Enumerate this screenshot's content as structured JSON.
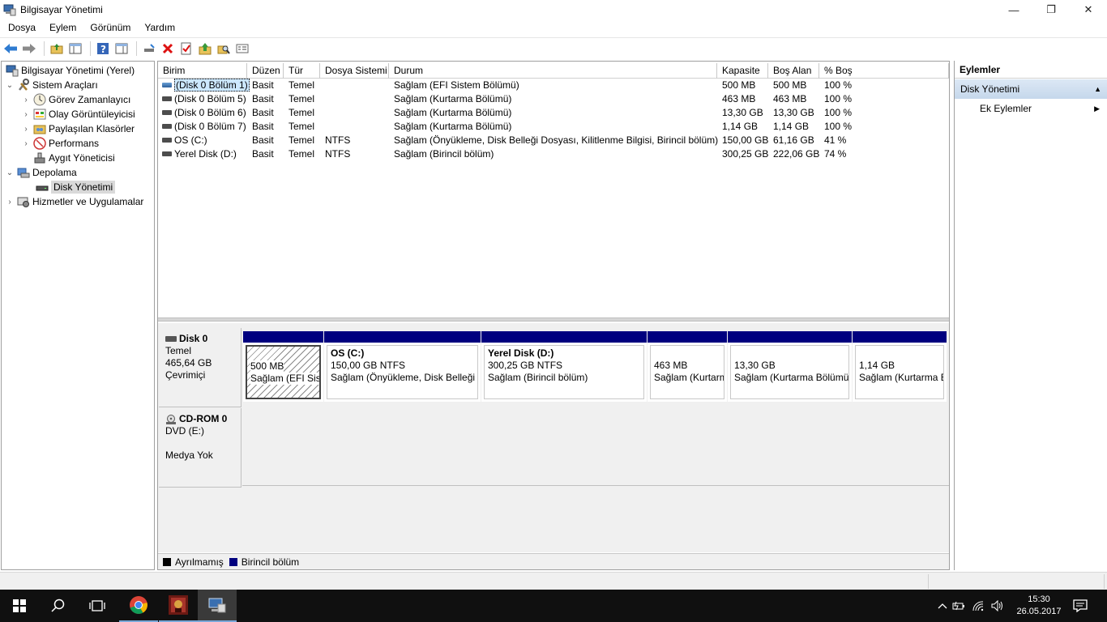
{
  "window": {
    "title": "Bilgisayar Yönetimi",
    "minimize": "—",
    "restore": "❐",
    "close": "✕"
  },
  "menu": [
    "Dosya",
    "Eylem",
    "Görünüm",
    "Yardım"
  ],
  "tree": {
    "root": "Bilgisayar Yönetimi (Yerel)",
    "system_tools": "Sistem Araçları",
    "task_scheduler": "Görev Zamanlayıcı",
    "event_viewer": "Olay Görüntüleyicisi",
    "shared_folders": "Paylaşılan Klasörler",
    "performance": "Performans",
    "device_manager": "Aygıt Yöneticisi",
    "storage": "Depolama",
    "disk_management": "Disk Yönetimi",
    "services": "Hizmetler ve Uygulamalar"
  },
  "grid": {
    "columns": [
      "Birim",
      "Düzen",
      "Tür",
      "Dosya Sistemi",
      "Durum",
      "Kapasite",
      "Boş Alan",
      "% Boş"
    ],
    "rows": [
      [
        "(Disk 0 Bölüm 1)",
        "Basit",
        "Temel",
        "",
        "Sağlam (EFI Sistem Bölümü)",
        "500 MB",
        "500 MB",
        "100 %"
      ],
      [
        "(Disk 0 Bölüm 5)",
        "Basit",
        "Temel",
        "",
        "Sağlam (Kurtarma Bölümü)",
        "463 MB",
        "463 MB",
        "100 %"
      ],
      [
        "(Disk 0 Bölüm 6)",
        "Basit",
        "Temel",
        "",
        "Sağlam (Kurtarma Bölümü)",
        "13,30 GB",
        "13,30 GB",
        "100 %"
      ],
      [
        "(Disk 0 Bölüm 7)",
        "Basit",
        "Temel",
        "",
        "Sağlam (Kurtarma Bölümü)",
        "1,14 GB",
        "1,14 GB",
        "100 %"
      ],
      [
        "OS (C:)",
        "Basit",
        "Temel",
        "NTFS",
        "Sağlam (Önyükleme, Disk Belleği Dosyası, Kilitlenme Bilgisi, Birincil bölüm)",
        "150,00 GB",
        "61,16 GB",
        "41 %"
      ],
      [
        "Yerel Disk (D:)",
        "Basit",
        "Temel",
        "NTFS",
        "Sağlam (Birincil bölüm)",
        "300,25 GB",
        "222,06 GB",
        "74 %"
      ]
    ]
  },
  "disk0": {
    "name": "Disk 0",
    "type": "Temel",
    "size": "465,64 GB",
    "status": "Çevrimiçi",
    "partitions": [
      {
        "title": "",
        "line1": "500 MB",
        "line2": "Sağlam (EFI Sistem Bölümü)"
      },
      {
        "title": "OS  (C:)",
        "line1": "150,00 GB NTFS",
        "line2": "Sağlam (Önyükleme, Disk Belleği Dosyası, Kilitlenme Bilgisi, Birincil bölüm)"
      },
      {
        "title": "Yerel Disk  (D:)",
        "line1": "300,25 GB NTFS",
        "line2": "Sağlam (Birincil bölüm)"
      },
      {
        "title": "",
        "line1": "463 MB",
        "line2": "Sağlam (Kurtarma Bölümü)"
      },
      {
        "title": "",
        "line1": "13,30 GB",
        "line2": "Sağlam (Kurtarma Bölümü)"
      },
      {
        "title": "",
        "line1": "1,14 GB",
        "line2": "Sağlam (Kurtarma Bölümü)"
      }
    ]
  },
  "cdrom": {
    "name": "CD-ROM 0",
    "drive": "DVD (E:)",
    "media": "Medya Yok"
  },
  "legend": {
    "unallocated": "Ayrılmamış",
    "primary": "Birincil bölüm",
    "unallocated_color": "#000000",
    "primary_color": "#00007f"
  },
  "actions": {
    "header": "Eylemler",
    "section": "Disk Yönetimi",
    "more": "Ek Eylemler"
  },
  "taskbar": {
    "time": "15:30",
    "date": "26.05.2017"
  }
}
